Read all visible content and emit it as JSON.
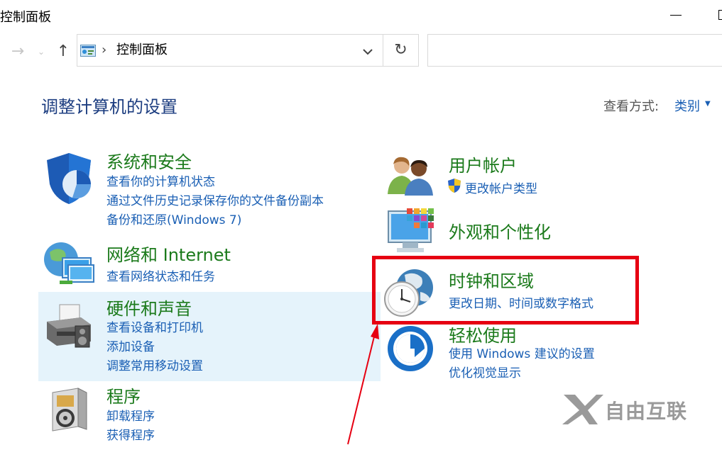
{
  "window": {
    "title": "控制面板"
  },
  "address": {
    "path": "控制面板",
    "separator": "›"
  },
  "search": {
    "placeholder": ""
  },
  "page": {
    "heading": "调整计算机的设置",
    "view_by_label": "查看方式:",
    "view_by_value": "类别"
  },
  "categories": {
    "system_security": {
      "title": "系统和安全",
      "links": [
        "查看你的计算机状态",
        "通过文件历史记录保存你的文件备份副本",
        "备份和还原(Windows 7)"
      ]
    },
    "network": {
      "title": "网络和 Internet",
      "links": [
        "查看网络状态和任务"
      ]
    },
    "hardware": {
      "title": "硬件和声音",
      "links": [
        "查看设备和打印机",
        "添加设备",
        "调整常用移动设置"
      ]
    },
    "programs": {
      "title": "程序",
      "links": [
        "卸载程序",
        "获得程序"
      ]
    },
    "user_accounts": {
      "title": "用户帐户",
      "links": [
        "更改帐户类型"
      ]
    },
    "appearance": {
      "title": "外观和个性化",
      "links": []
    },
    "clock_region": {
      "title": "时钟和区域",
      "links": [
        "更改日期、时间或数字格式"
      ]
    },
    "ease_of_access": {
      "title": "轻松使用",
      "links": [
        "使用 Windows 建议的设置",
        "优化视觉显示"
      ]
    }
  },
  "watermark": {
    "text": "自由互联"
  },
  "colors": {
    "category_title": "#1b7a1b",
    "link": "#1a5fb4",
    "heading": "#1c3d80",
    "highlight_box": "#e60012",
    "hover_bg": "#e5f3fb"
  }
}
